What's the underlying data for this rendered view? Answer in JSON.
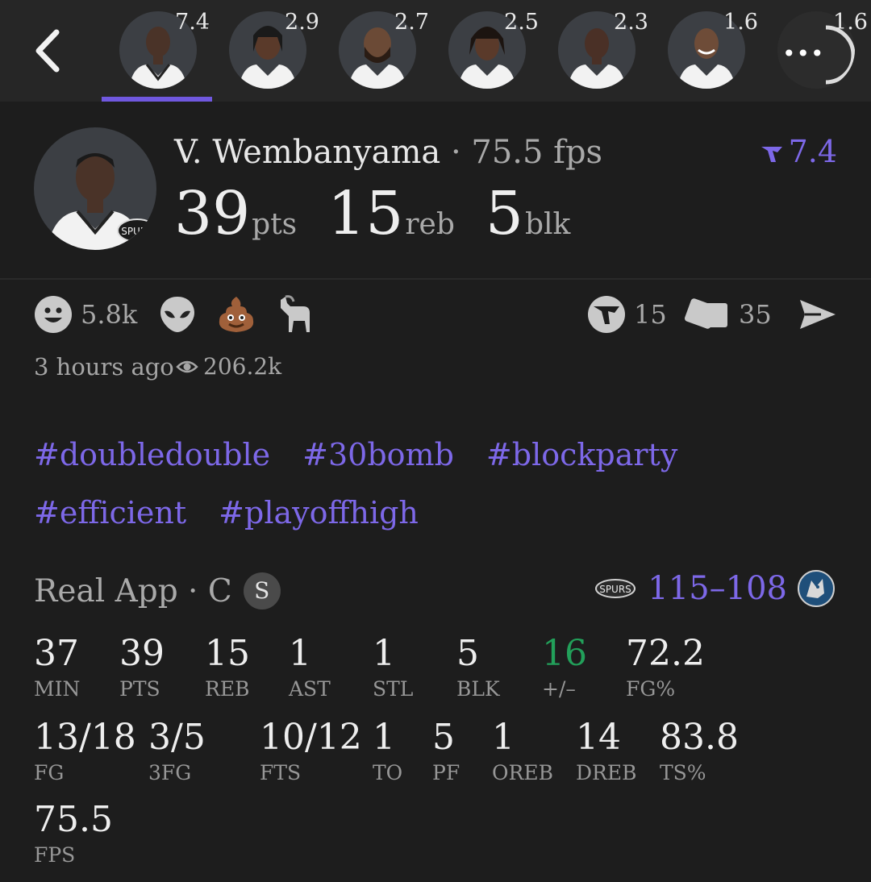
{
  "topbar": {
    "players": [
      {
        "name": "V. Wembanyama",
        "rating": "7.4",
        "selected": true
      },
      {
        "name": "player-2",
        "rating": "2.9"
      },
      {
        "name": "player-3",
        "rating": "2.7"
      },
      {
        "name": "player-4",
        "rating": "2.5"
      },
      {
        "name": "player-5",
        "rating": "2.3"
      },
      {
        "name": "player-6",
        "rating": "1.6"
      },
      {
        "name": "player-7",
        "rating": "1.6"
      }
    ],
    "more_label": "•••",
    "back_icon": "chevron-left-icon"
  },
  "player": {
    "name": "V. Wembanyama",
    "fps_text": "· 75.5 fps",
    "rating": "7.4",
    "team_logo_text": "SPURS",
    "line": [
      {
        "value": "39",
        "unit": "pts"
      },
      {
        "value": "15",
        "unit": "reb"
      },
      {
        "value": "5",
        "unit": "blk"
      }
    ]
  },
  "reactions": {
    "smile_count": "5.8k",
    "icons": [
      "smile-icon",
      "alien-icon",
      "poop-icon",
      "goat-icon"
    ],
    "votes_count": "15",
    "cards_count": "35",
    "share_icon": "send-icon"
  },
  "meta": {
    "time": "3 hours ago",
    "views": "206.2k"
  },
  "tags": [
    "#doubledouble",
    "#30bomb",
    "#blockparty",
    "#efficient",
    "#playoffhigh"
  ],
  "game": {
    "source": "Real App · C",
    "position_badge": "S",
    "score": "115–108",
    "home_logo_text": "SPURS"
  },
  "stats": [
    {
      "value": "37",
      "label": "MIN"
    },
    {
      "value": "39",
      "label": "PTS"
    },
    {
      "value": "15",
      "label": "REB"
    },
    {
      "value": "1",
      "label": "AST"
    },
    {
      "value": "1",
      "label": "STL"
    },
    {
      "value": "5",
      "label": "BLK"
    },
    {
      "value": "16",
      "label": "+/–"
    },
    {
      "value": "72.2",
      "label": "FG%"
    },
    {
      "value": "13/18",
      "label": "FG"
    },
    {
      "value": "3/5",
      "label": "3FG"
    },
    {
      "value": "10/12",
      "label": "FTS"
    },
    {
      "value": "1",
      "label": "TO"
    },
    {
      "value": "5",
      "label": "PF"
    },
    {
      "value": "1",
      "label": "OREB"
    },
    {
      "value": "14",
      "label": "DREB"
    },
    {
      "value": "83.8",
      "label": "TS%"
    },
    {
      "value": "75.5",
      "label": "FPS"
    }
  ],
  "colors": {
    "accent": "#7d68e8",
    "positive": "#22a05a",
    "background": "#1d1d1d",
    "topbar": "#262626"
  }
}
